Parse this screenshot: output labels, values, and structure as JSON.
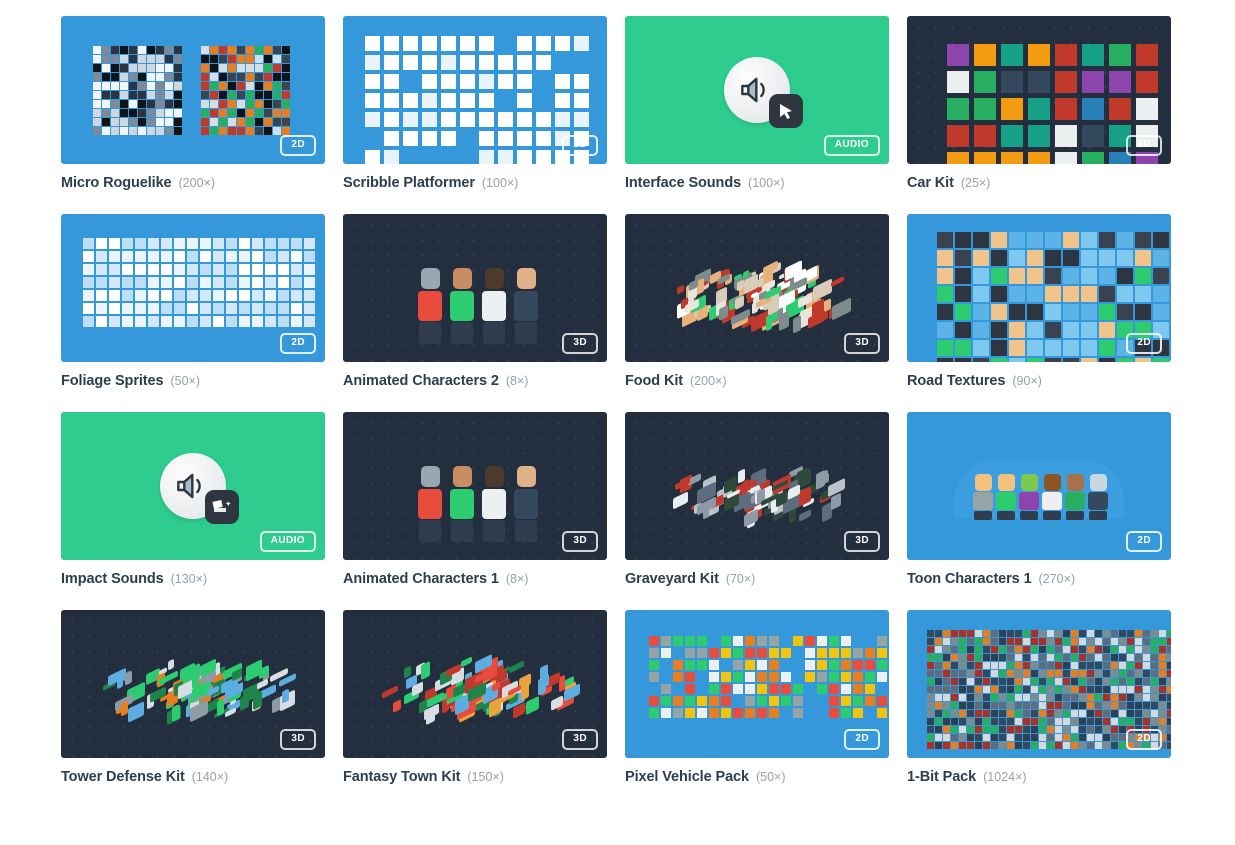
{
  "page": {
    "background": "#ffffff",
    "columns": 4,
    "title_color": "#2c3e50",
    "count_color": "#95a1ab"
  },
  "badge_types": {
    "two_d": "2D",
    "three_d": "3D",
    "audio": "AUDIO"
  },
  "thumb_colors": {
    "blue": "#3498db",
    "green": "#2ecc8f",
    "dark": "#232f3e"
  },
  "cards": [
    {
      "title": "Micro Roguelike",
      "count": "(200×)",
      "badge": "2D",
      "theme": "blue",
      "art": "sprite-sheet-pair"
    },
    {
      "title": "Scribble Platformer",
      "count": "(100×)",
      "badge": "2D",
      "theme": "blue",
      "art": "scribble-icons"
    },
    {
      "title": "Interface Sounds",
      "count": "(100×)",
      "badge": "AUDIO",
      "theme": "green",
      "art": "speaker-cursor"
    },
    {
      "title": "Car Kit",
      "count": "(25×)",
      "badge": "3D",
      "theme": "dark",
      "art": "car-grid"
    },
    {
      "title": "Foliage Sprites",
      "count": "(50×)",
      "badge": "2D",
      "theme": "blue",
      "art": "foliage-grid"
    },
    {
      "title": "Animated Characters 2",
      "count": "(8×)",
      "badge": "3D",
      "theme": "dark",
      "art": "characters-row"
    },
    {
      "title": "Food Kit",
      "count": "(200×)",
      "badge": "3D",
      "theme": "dark",
      "art": "food-spread"
    },
    {
      "title": "Road Textures",
      "count": "(90×)",
      "badge": "2D",
      "theme": "blue",
      "art": "road-tiles"
    },
    {
      "title": "Impact Sounds",
      "count": "(130×)",
      "badge": "AUDIO",
      "theme": "green",
      "art": "speaker-impact"
    },
    {
      "title": "Animated Characters 1",
      "count": "(8×)",
      "badge": "3D",
      "theme": "dark",
      "art": "characters-row"
    },
    {
      "title": "Graveyard Kit",
      "count": "(70×)",
      "badge": "3D",
      "theme": "dark",
      "art": "graveyard-iso"
    },
    {
      "title": "Toon Characters 1",
      "count": "(270×)",
      "badge": "2D",
      "theme": "blue",
      "art": "toon-row"
    },
    {
      "title": "Tower Defense Kit",
      "count": "(140×)",
      "badge": "3D",
      "theme": "dark",
      "art": "tower-iso"
    },
    {
      "title": "Fantasy Town Kit",
      "count": "(150×)",
      "badge": "3D",
      "theme": "dark",
      "art": "town-iso"
    },
    {
      "title": "Pixel Vehicle Pack",
      "count": "(50×)",
      "badge": "2D",
      "theme": "blue",
      "art": "vehicle-sheet"
    },
    {
      "title": "1-Bit Pack",
      "count": "(1024×)",
      "badge": "2D",
      "theme": "blue",
      "art": "onebit-sheet"
    }
  ]
}
